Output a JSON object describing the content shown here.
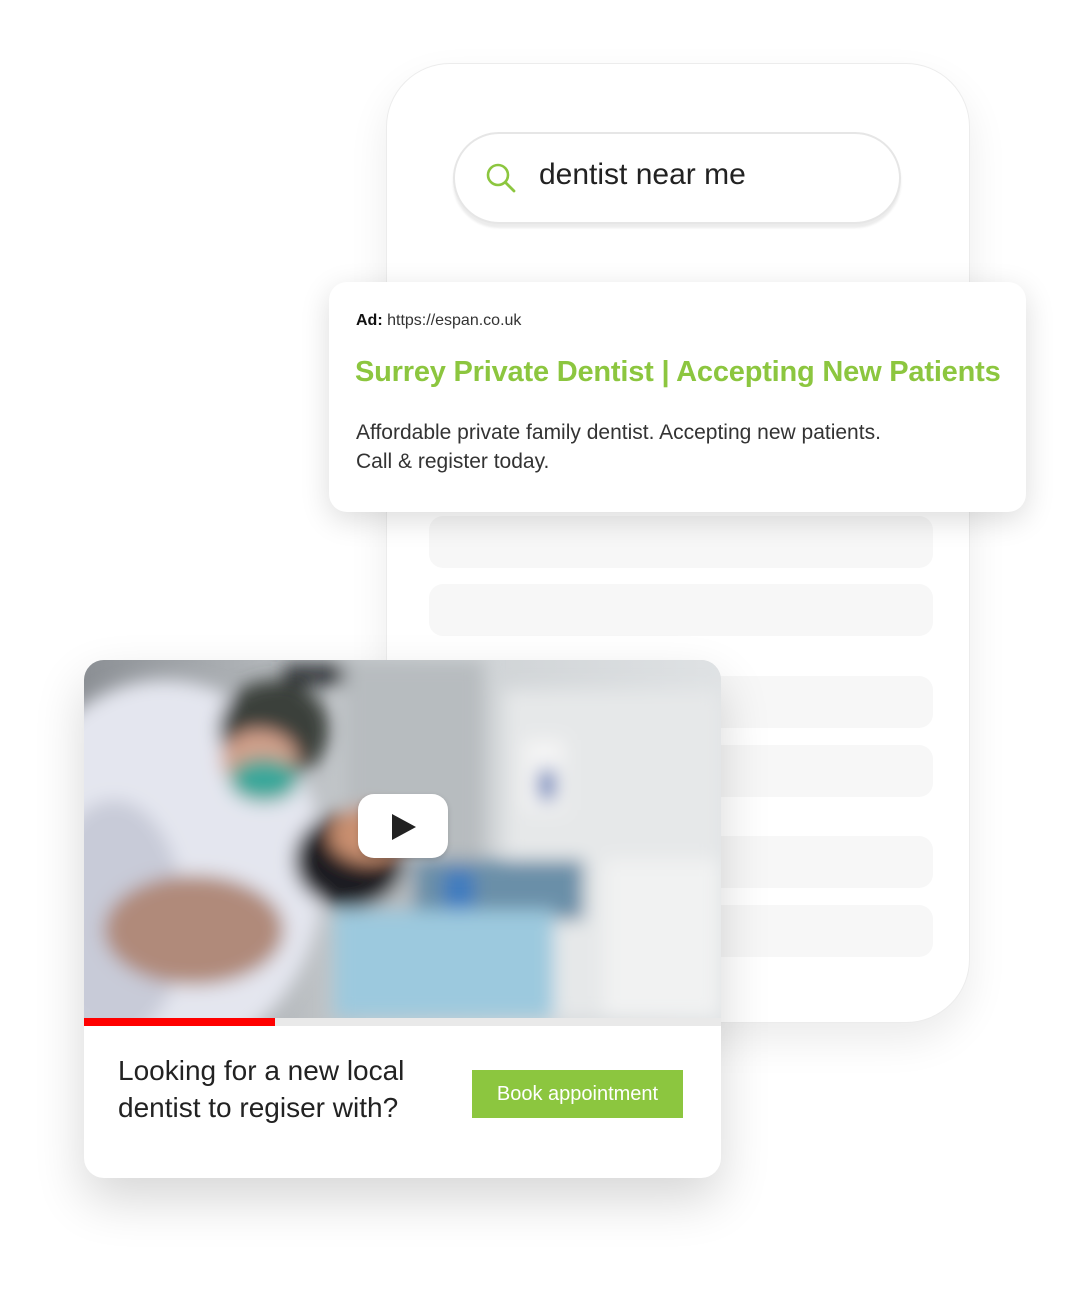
{
  "search": {
    "query": "dentist near me"
  },
  "ad": {
    "label": "Ad:",
    "url": "https://espan.co.uk",
    "title": "Surrey Private Dentist | Accepting New Patients",
    "description_line1": "Affordable private family dentist. Accepting new patients.",
    "description_line2": "Call & register today."
  },
  "video": {
    "progress": 0.3,
    "cta_line1": "Looking for a new local",
    "cta_line2": "dentist to regiser with?",
    "button_label": "Book appointment"
  },
  "colors": {
    "accent": "#8cc63f",
    "progress": "#ff0000"
  },
  "icons": [
    "search-icon",
    "play-icon"
  ]
}
